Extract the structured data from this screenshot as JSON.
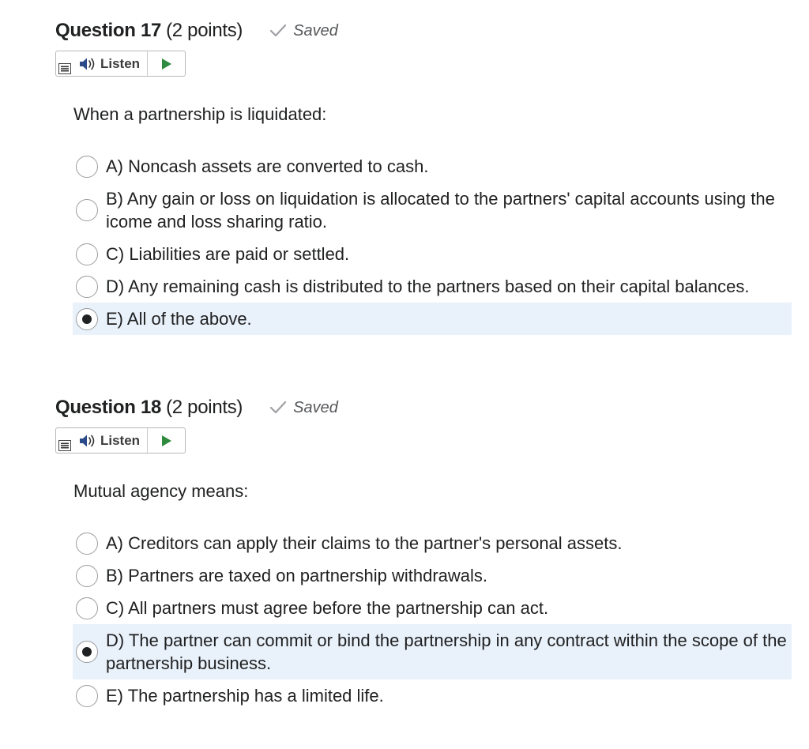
{
  "questions": [
    {
      "number_label": "Question 17",
      "points_label": "(2 points)",
      "saved_label": "Saved",
      "listen_label": "Listen",
      "prompt": "When a partnership is liquidated:",
      "options": [
        {
          "label": "A) Noncash assets are converted to cash.",
          "selected": false
        },
        {
          "label": "B) Any gain or loss on liquidation is allocated to the partners' capital accounts using the icome and loss sharing ratio.",
          "selected": false
        },
        {
          "label": "C) Liabilities are paid or settled.",
          "selected": false
        },
        {
          "label": "D) Any remaining cash is distributed to the partners based on their capital balances.",
          "selected": false
        },
        {
          "label": "E) All of the above.",
          "selected": true
        }
      ]
    },
    {
      "number_label": "Question 18",
      "points_label": "(2 points)",
      "saved_label": "Saved",
      "listen_label": "Listen",
      "prompt": "Mutual agency means:",
      "options": [
        {
          "label": "A) Creditors can apply their claims to the partner's personal assets.",
          "selected": false
        },
        {
          "label": "B) Partners are taxed on partnership withdrawals.",
          "selected": false
        },
        {
          "label": "C) All partners must agree before the partnership can act.",
          "selected": false
        },
        {
          "label": "D) The partner can commit or bind the partnership in any contract within the scope of the partnership business.",
          "selected": true
        },
        {
          "label": "E) The partnership has a limited life.",
          "selected": false
        }
      ]
    }
  ],
  "icons": {
    "saved": "checkmark-icon",
    "listen": "speaker-icon",
    "play": "play-icon",
    "menu": "menu-icon"
  },
  "colors": {
    "selected_row_bg": "#e9f1fa",
    "play_green": "#2e8b3d",
    "saved_gray": "#56585b"
  }
}
